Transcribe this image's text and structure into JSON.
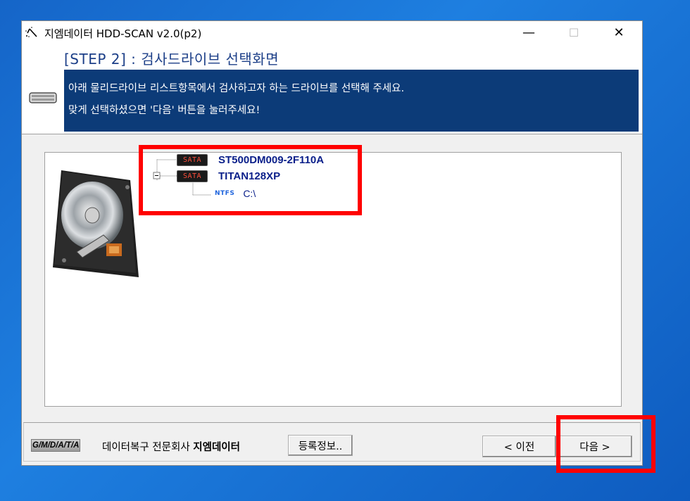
{
  "window": {
    "title": "지엠데이터 HDD-SCAN v2.0(p2)",
    "controls": {
      "minimize": "—",
      "maximize": "☐",
      "close": "✕"
    }
  },
  "header": {
    "step_title": "[STEP 2] : 검사드라이브 선택화면",
    "info_lines": [
      "아래 물리드라이브 리스트항목에서 검사하고자 하는 드라이브를 선택해 주세요.",
      "맞게 선택하셨으면 '다음' 버튼을 눌러주세요!"
    ]
  },
  "drive_tree": {
    "drives": [
      {
        "interface": "SATA",
        "name": "ST500DM009-2F110A",
        "partitions": []
      },
      {
        "interface": "SATA",
        "name": "TITAN128XP",
        "expanded_icon": "⊟",
        "partitions": [
          {
            "fs": "NTFS",
            "label": "C:\\"
          }
        ]
      }
    ]
  },
  "footer": {
    "logo": "G/M/D/A/T/A",
    "company_prefix": "데이터복구 전문회사 ",
    "company_name": "지엠데이터",
    "register_button": "등록정보..",
    "prev_button": "< 이전",
    "next_button": "다음 >"
  },
  "colors": {
    "accent": "#0c3b78",
    "step_title": "#1c3f88",
    "highlight": "#ff0000",
    "drive_text": "#0a1f8a",
    "desktop": "#1e7fe0"
  },
  "icons": {
    "app": "scan-sparkle-icon",
    "header": "hdd-icon",
    "content": "hard-disk-image"
  }
}
